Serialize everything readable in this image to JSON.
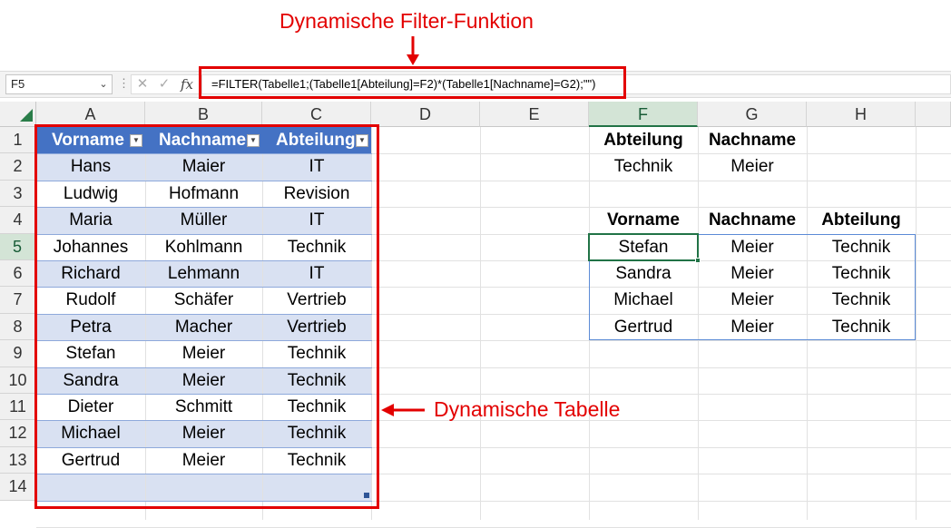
{
  "annotations": {
    "top": "Dynamische Filter-Funktion",
    "right": "Dynamische Tabelle"
  },
  "formula_bar": {
    "name_box": "F5",
    "formula": "=FILTER(Tabelle1;(Tabelle1[Abteilung]=F2)*(Tabelle1[Nachname]=G2);\"\")"
  },
  "columns": [
    "A",
    "B",
    "C",
    "D",
    "E",
    "F",
    "G",
    "H"
  ],
  "rows": [
    "1",
    "2",
    "3",
    "4",
    "5",
    "6",
    "7",
    "8",
    "9",
    "10",
    "11",
    "12",
    "13",
    "14"
  ],
  "source_table": {
    "headers": [
      "Vorname",
      "Nachname",
      "Abteilung"
    ],
    "rows": [
      [
        "Hans",
        "Maier",
        "IT"
      ],
      [
        "Ludwig",
        "Hofmann",
        "Revision"
      ],
      [
        "Maria",
        "Müller",
        "IT"
      ],
      [
        "Johannes",
        "Kohlmann",
        "Technik"
      ],
      [
        "Richard",
        "Lehmann",
        "IT"
      ],
      [
        "Rudolf",
        "Schäfer",
        "Vertrieb"
      ],
      [
        "Petra",
        "Macher",
        "Vertrieb"
      ],
      [
        "Stefan",
        "Meier",
        "Technik"
      ],
      [
        "Sandra",
        "Meier",
        "Technik"
      ],
      [
        "Dieter",
        "Schmitt",
        "Technik"
      ],
      [
        "Michael",
        "Meier",
        "Technik"
      ],
      [
        "Gertrud",
        "Meier",
        "Technik"
      ]
    ]
  },
  "criteria": {
    "headers": [
      "Abteilung",
      "Nachname"
    ],
    "values": [
      "Technik",
      "Meier"
    ]
  },
  "result": {
    "headers": [
      "Vorname",
      "Nachname",
      "Abteilung"
    ],
    "rows": [
      [
        "Stefan",
        "Meier",
        "Technik"
      ],
      [
        "Sandra",
        "Meier",
        "Technik"
      ],
      [
        "Michael",
        "Meier",
        "Technik"
      ],
      [
        "Gertrud",
        "Meier",
        "Technik"
      ]
    ]
  },
  "selected_cell": "F5",
  "colors": {
    "table_header": "#4472c4",
    "table_band": "#d9e1f2",
    "annotation": "#e30000",
    "selection": "#217346"
  }
}
